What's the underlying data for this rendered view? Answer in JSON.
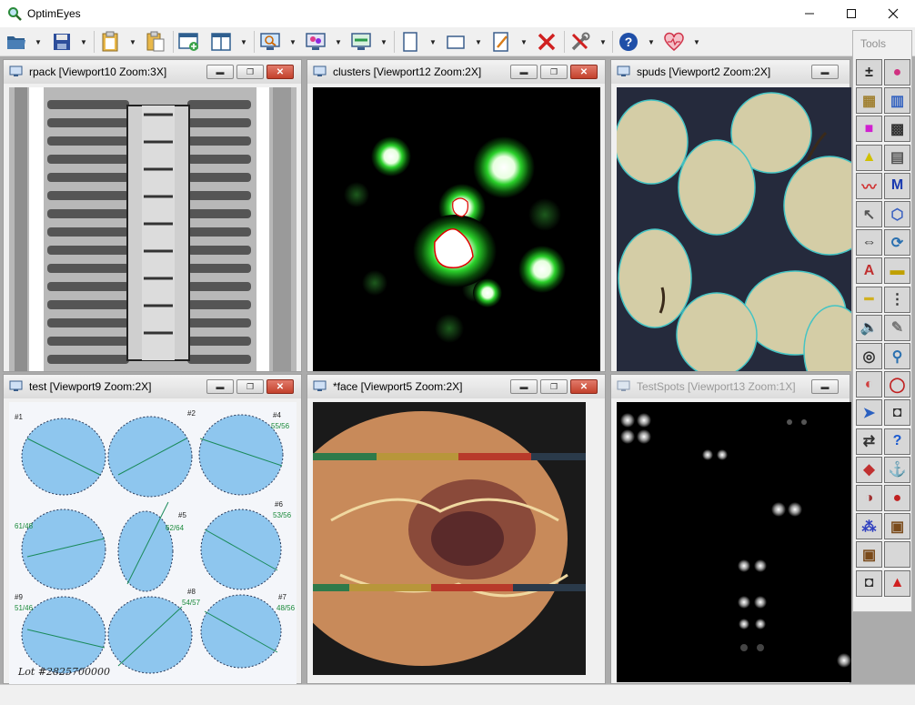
{
  "window": {
    "title": "OptimEyes",
    "icon": "magnifier-icon",
    "controls": [
      "minimize",
      "maximize",
      "close"
    ]
  },
  "toolbar": {
    "buttons": [
      {
        "name": "open",
        "icon": "folder-open-icon",
        "dropdown": true
      },
      {
        "name": "save",
        "icon": "floppy-disk-icon",
        "dropdown": true
      },
      {
        "name": "clipboard",
        "icon": "clipboard-icon",
        "dropdown": true
      },
      {
        "name": "paste",
        "icon": "paste-icon",
        "dropdown": false
      },
      {
        "name": "new-window",
        "icon": "new-window-icon",
        "dropdown": false
      },
      {
        "name": "tile-windows",
        "icon": "tile-windows-icon",
        "dropdown": true
      },
      {
        "name": "zoom-view",
        "icon": "monitor-magnifier-icon",
        "dropdown": true
      },
      {
        "name": "color-view",
        "icon": "monitor-color-icon",
        "dropdown": true
      },
      {
        "name": "capture-view",
        "icon": "monitor-capture-icon",
        "dropdown": true
      },
      {
        "name": "page-frame",
        "icon": "page-frame-icon",
        "dropdown": true
      },
      {
        "name": "rect-frame",
        "icon": "rectangle-frame-icon",
        "dropdown": true
      },
      {
        "name": "edit-note",
        "icon": "pencil-note-icon",
        "dropdown": true
      },
      {
        "name": "delete",
        "icon": "red-x-icon",
        "dropdown": false
      },
      {
        "name": "tools",
        "icon": "wrench-screwdriver-icon",
        "dropdown": true
      },
      {
        "name": "help",
        "icon": "help-icon",
        "dropdown": true
      },
      {
        "name": "health",
        "icon": "heart-monitor-icon",
        "dropdown": true
      }
    ]
  },
  "viewports": [
    {
      "title": "rpack [Viewport10 Zoom:3X]",
      "content": "ic-chip-image",
      "active": true
    },
    {
      "title": "clusters [Viewport12 Zoom:2X]",
      "content": "cluster-heatmap",
      "active": true
    },
    {
      "title": "spuds [Viewport2 Zoom:2X]",
      "content": "potatoes-image",
      "active": true
    },
    {
      "title": "test [Viewport9 Zoom:2X]",
      "content": "blue-plate-image",
      "active": true,
      "annotations": [
        "Lot #2825700000",
        "#1",
        "#2",
        "#4",
        "#5",
        "#6",
        "#7",
        "#8",
        "#9",
        "55/56",
        "61/48",
        "62/64",
        "53/56",
        "54/57",
        "51/46",
        "48/56"
      ]
    },
    {
      "title": "*face [Viewport5 Zoom:2X]",
      "content": "face-section-image",
      "active": true
    },
    {
      "title": "TestSpots [Viewport13 Zoom:1X]",
      "content": "spots-image",
      "active": false
    }
  ],
  "tools_panel": {
    "title": "Tools",
    "items": [
      "calc-1-2-icon",
      "color-dots-icon",
      "blocks-icon",
      "crayons-icon",
      "magenta-square-icon",
      "binary-grid-icon",
      "triangle-peak-icon",
      "film-ruler-icon",
      "line-graph-icon",
      "m-letter-icon",
      "select-arrow-icon",
      "polygon-outline-icon",
      "measure-arrows-icon",
      "rotate-arrows-icon",
      "abc-text-icon",
      "ruler-stack-icon",
      "yellow-ruler-icon",
      "compare-lines-icon",
      "speaker-icon",
      "pencil-icon",
      "binoculars-icon",
      "color-magnifier-icon",
      "color-wheel-icon",
      "red-outline-icon",
      "color-arrow-icon",
      "camera-icon",
      "swap-arrows-icon",
      "question-icon",
      "rgb-cube-icon",
      "anchor-icon",
      "abc-glasses-icon",
      "red-blob-icon",
      "scatter-dots-icon",
      "film-strip-icon",
      "film-frame-icon",
      "blank-tool-icon",
      "camera-alt-icon",
      "red-cone-icon"
    ]
  }
}
